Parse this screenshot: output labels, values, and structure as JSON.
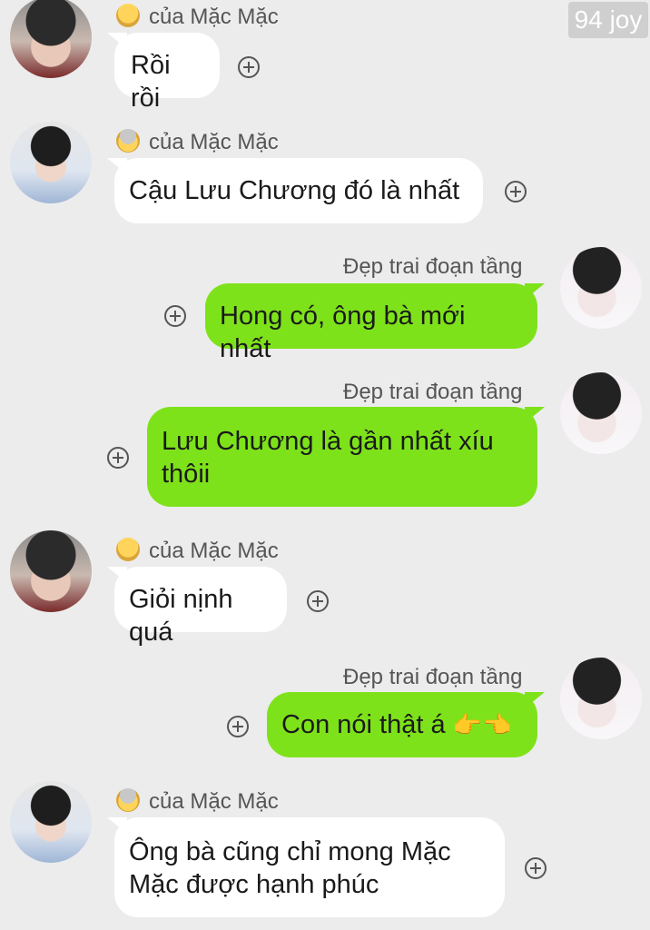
{
  "watermark": "94 joy",
  "messages": [
    {
      "sender": "của Mặc Mặc",
      "text": "Rồi rồi",
      "direction": "incoming"
    },
    {
      "sender": "của Mặc Mặc",
      "text": "Cậu Lưu Chương đó là nhất",
      "direction": "incoming"
    },
    {
      "sender": "Đẹp trai đoạn tầng",
      "text": "Hong có, ông bà mới nhất",
      "direction": "outgoing"
    },
    {
      "sender": "Đẹp trai đoạn tầng",
      "text": "Lưu Chương là gần nhất xíu thôii",
      "direction": "outgoing"
    },
    {
      "sender": "của Mặc Mặc",
      "text": "Giỏi nịnh quá",
      "direction": "incoming"
    },
    {
      "sender": "Đẹp trai đoạn tầng",
      "text": "Con nói thật á",
      "emoji": "👉👈",
      "direction": "outgoing"
    },
    {
      "sender": "của Mặc Mặc",
      "text": "Ông bà cũng chỉ mong Mặc Mặc được hạnh phúc",
      "direction": "incoming"
    }
  ],
  "colors": {
    "background": "#ececec",
    "incoming_bubble": "#ffffff",
    "outgoing_bubble": "#7ee21b",
    "sender_text": "#555555"
  },
  "icons": {
    "react": "plus-circle-icon",
    "sender_badge": "emoji-face-icon"
  }
}
